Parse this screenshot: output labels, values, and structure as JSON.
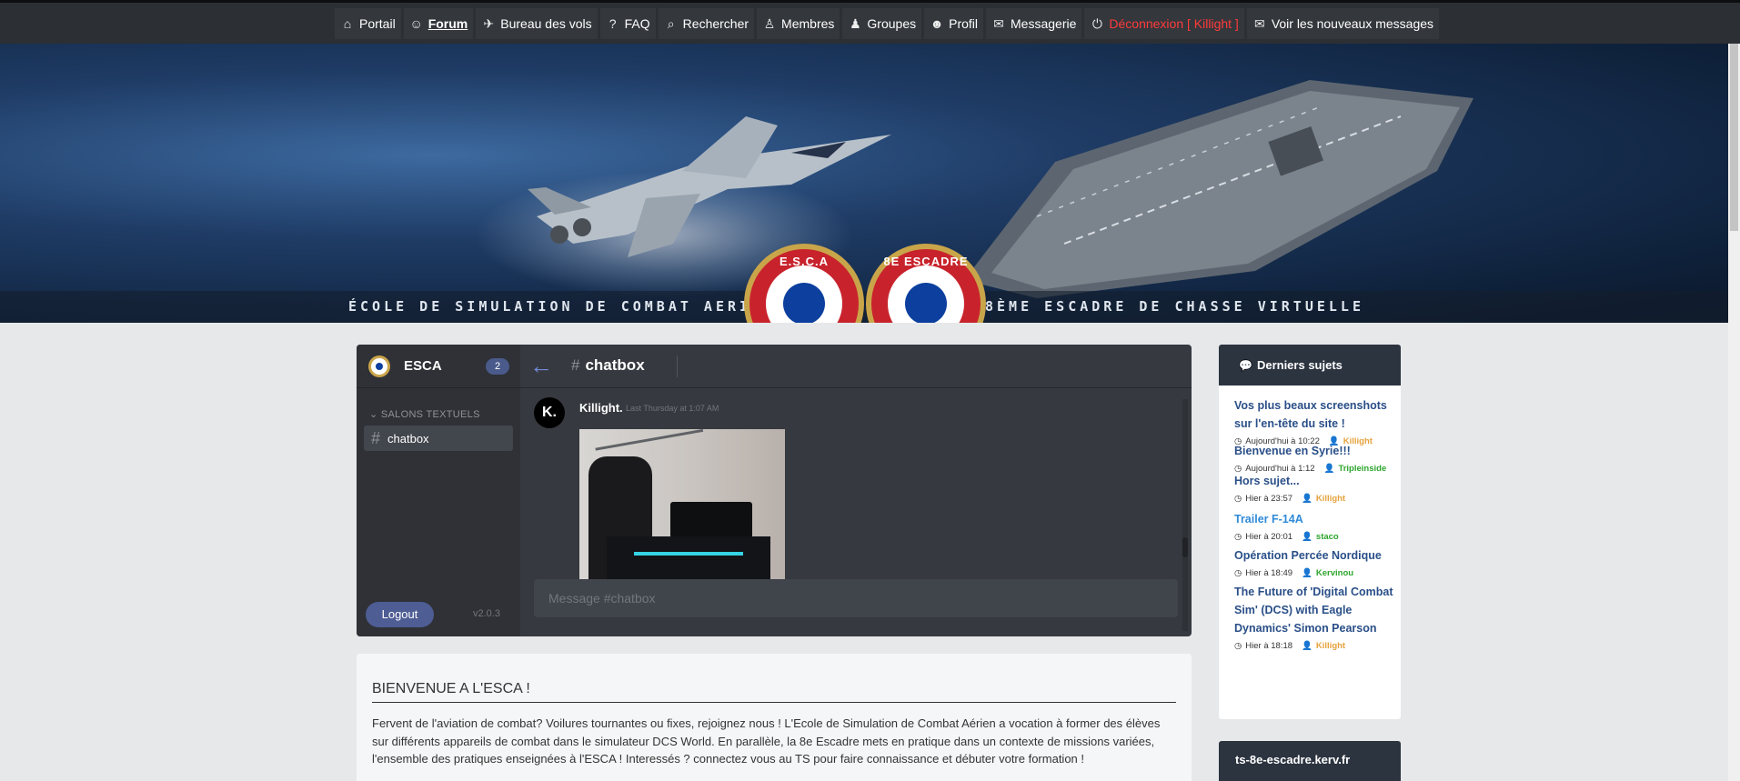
{
  "nav": [
    {
      "label": "Portail",
      "icon": "home-icon",
      "glyph": "⌂",
      "state": "normal"
    },
    {
      "label": "Forum",
      "icon": "forum-icon",
      "glyph": "☺",
      "state": "active"
    },
    {
      "label": "Bureau des vols",
      "icon": "flight-office-icon",
      "glyph": "✈",
      "state": "normal"
    },
    {
      "label": "FAQ",
      "icon": "faq-icon",
      "glyph": "?",
      "state": "normal"
    },
    {
      "label": "Rechercher",
      "icon": "search-icon",
      "glyph": "⌕",
      "state": "normal"
    },
    {
      "label": "Membres",
      "icon": "members-icon",
      "glyph": "♙",
      "state": "normal"
    },
    {
      "label": "Groupes",
      "icon": "groups-icon",
      "glyph": "♟",
      "state": "normal"
    },
    {
      "label": "Profil",
      "icon": "profile-icon",
      "glyph": "☻",
      "state": "normal"
    },
    {
      "label": "Messagerie",
      "icon": "mail-icon",
      "glyph": "✉",
      "state": "normal"
    },
    {
      "label": "Déconnexion [ Killight ]",
      "icon": "logout-icon",
      "glyph": "⏻",
      "state": "logout"
    },
    {
      "label": "Voir les nouveaux messages",
      "icon": "new-messages-icon",
      "glyph": "✉",
      "state": "normal"
    }
  ],
  "banner": {
    "left_slogan": "ÉCOLE DE SIMULATION DE COMBAT AERIEN",
    "right_slogan": "8ÈME ESCADRE DE CHASSE VIRTUELLE",
    "badge_left": "E.S.C.A",
    "badge_right": "8E ESCADRE"
  },
  "chat": {
    "server_name": "ESCA",
    "member_count": "2",
    "category": "SALONS TEXTUELS",
    "channel": "chatbox",
    "channel_title": "chatbox",
    "logout_label": "Logout",
    "version": "v2.0.3",
    "message": {
      "avatar_text": "K.",
      "author": "Killight.",
      "time": "Last Thursday at 1:07 AM"
    },
    "input_placeholder": "Message #chatbox"
  },
  "welcome": {
    "title": "BIENVENUE A L'ESCA !",
    "body": "Fervent de l'aviation de combat? Voilures tournantes ou fixes, rejoignez nous ! L'Ecole de Simulation de Combat Aérien a vocation à former des élèves sur différents appareils de combat dans le simulateur DCS World. En parallèle, la 8e Escadre mets en pratique dans un contexte de missions variées, l'ensemble des pratiques enseignées à l'ESCA ! Interessés ? connectez vous au TS pour faire connaissance et débuter votre formation !"
  },
  "topics": {
    "title": "Derniers sujets",
    "items": [
      {
        "title": "Vos plus beaux screenshots sur l'en-tête du site !",
        "date": "Aujourd'hui à 10:22",
        "user": "Killight",
        "user_color": "#e6a23c",
        "highlight": false
      },
      {
        "title": "Bienvenue en Syrie!!!",
        "date": "Aujourd'hui à 1:12",
        "user": "Tripleinside",
        "user_color": "#2ea52e",
        "highlight": false
      },
      {
        "title": "Hors sujet...",
        "date": "Hier à 23:57",
        "user": "Killight",
        "user_color": "#e6a23c",
        "highlight": false
      },
      {
        "title": "Trailer F-14A",
        "date": "Hier à 20:01",
        "user": "staco",
        "user_color": "#2ea52e",
        "highlight": true
      },
      {
        "title": "Opération Percée Nordique",
        "date": "Hier à 18:49",
        "user": "Kervinou",
        "user_color": "#2ea52e",
        "highlight": false
      },
      {
        "title": "The Future of 'Digital Combat Sim' (DCS) with Eagle Dynamics' Simon Pearson",
        "date": "Hier à 18:18",
        "user": "Killight",
        "user_color": "#e6a23c",
        "highlight": false
      }
    ]
  },
  "teamspeak": {
    "label": "ts-8e-escadre.kerv.fr"
  }
}
